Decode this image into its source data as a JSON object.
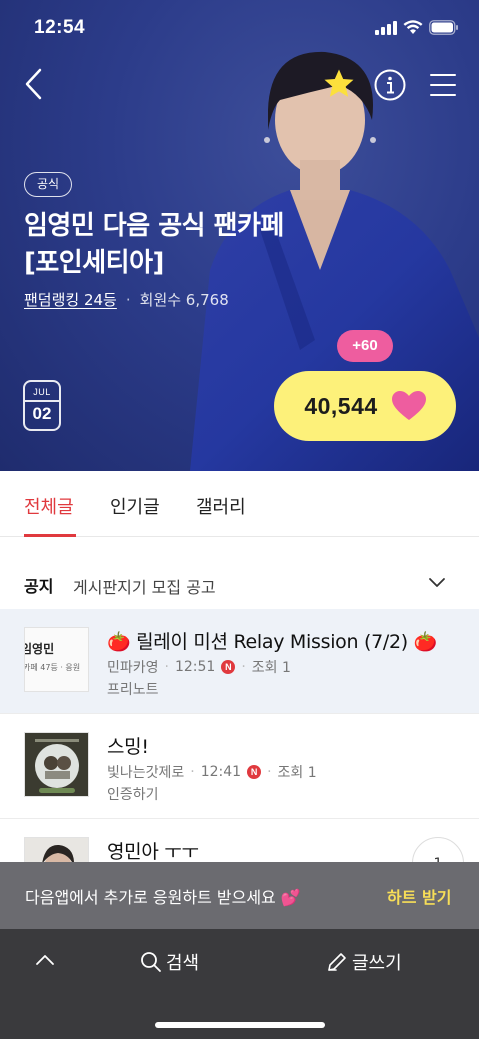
{
  "status_bar": {
    "time": "12:54"
  },
  "cafe": {
    "badge": "공식",
    "title": "임영민 다음 공식 팬카페 [포인세티아]",
    "rank": "팬덤랭킹 24등",
    "separator": "·",
    "members": "회원수 6,768"
  },
  "date_badge": {
    "month": "JUL",
    "day": "02"
  },
  "hearts": {
    "plus": "+60",
    "count": "40,544"
  },
  "tabs": [
    {
      "label": "전체글",
      "active": true
    },
    {
      "label": "인기글",
      "active": false
    },
    {
      "label": "갤러리",
      "active": false
    }
  ],
  "notice": {
    "label": "공지",
    "text": "게시판지기 모집 공고"
  },
  "posts": [
    {
      "title": "🍅 릴레이 미션 Relay Mission (7/2) 🍅",
      "author": "민파카영",
      "time": "12:51",
      "new_badge": "N",
      "views": "조회 1",
      "category": "프리노트",
      "thumb_text": "임영민",
      "thumb_sub": "카페 47등 · 응원"
    },
    {
      "title": "스밍!",
      "author": "빛나는갓제로",
      "time": "12:41",
      "new_badge": "N",
      "views": "조회 1",
      "category": "인증하기"
    },
    {
      "title": "영민아 ㅜㅜ",
      "comments": "1"
    }
  ],
  "promo": {
    "text": "다음앱에서 추가로 응원하트 받으세요 💕",
    "action": "하트 받기"
  },
  "bottom_nav": {
    "search": "검색",
    "write": "글쓰기"
  },
  "colors": {
    "accent": "#e0393e",
    "heart": "#ee5d9f",
    "pill": "#fdf17a",
    "hero": "#2c3c8a"
  }
}
